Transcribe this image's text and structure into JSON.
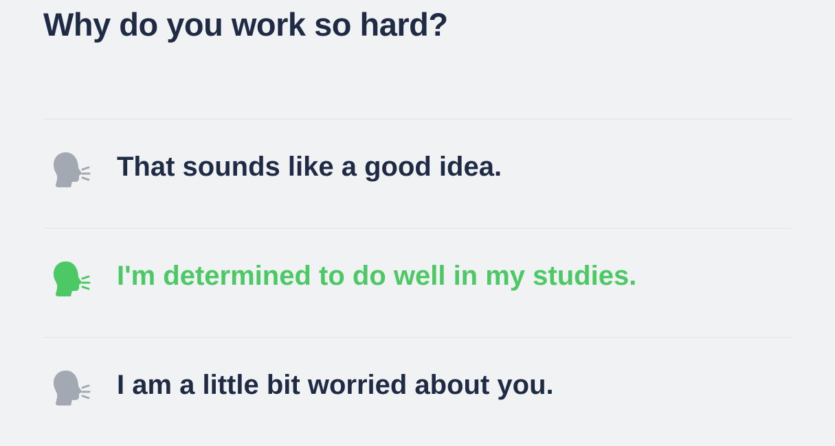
{
  "question": "Why do you work so hard?",
  "options": [
    {
      "text": "That sounds like a good idea.",
      "selected": false,
      "icon": "speaking-head-icon"
    },
    {
      "text": "I'm determined to do well in my studies.",
      "selected": true,
      "icon": "speaking-head-icon"
    },
    {
      "text": "I am a little bit worried about you.",
      "selected": false,
      "icon": "speaking-head-icon"
    }
  ],
  "colors": {
    "text": "#1f2a44",
    "selected": "#4cc864",
    "icon_default": "#a3a9b3",
    "background": "#f1f2f4",
    "divider": "#e1e3e7"
  }
}
